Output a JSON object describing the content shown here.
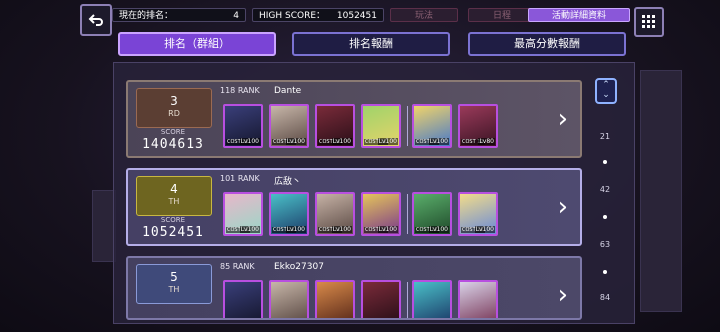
{
  "header": {
    "current_rank_label": "現在的排名：",
    "current_rank_value": "4",
    "high_score_label": "HIGH SCORE：",
    "high_score_value": "1052451",
    "btn_rules": "玩法",
    "btn_schedule": "日程",
    "btn_event_details": "活動詳細資料"
  },
  "tabs": [
    {
      "label": "排名（群組）",
      "active": true
    },
    {
      "label": "排名報酬",
      "active": false
    },
    {
      "label": "最高分數報酬",
      "active": false
    }
  ],
  "rows": [
    {
      "rank": "3",
      "suffix": "RD",
      "score_label": "SCORE",
      "score": "1404613",
      "prev_rank": "118 RANK",
      "name": "Dante",
      "cards": [
        {
          "lv": "Lv100",
          "cost": "COST 12",
          "color": "#3a3f7a"
        },
        {
          "lv": "Lv100",
          "cost": "COST 12",
          "color": "#c7b6a9"
        },
        {
          "lv": "Lv100",
          "cost": "COST 12",
          "color": "#7a2b3a"
        },
        {
          "lv": "Lv100",
          "cost": "COST 12",
          "color": "#9fd36a"
        },
        {
          "lv": "Lv100",
          "cost": "COST 12",
          "color": "#f0d36a"
        },
        {
          "lv": "Lv80",
          "cost": "COST 12",
          "color": "#9a3a5a"
        }
      ]
    },
    {
      "rank": "4",
      "suffix": "TH",
      "score_label": "SCORE",
      "score": "1052451",
      "prev_rank": "101 RANK",
      "name": "広敌丶",
      "cards": [
        {
          "lv": "Lv100",
          "cost": "COST 12",
          "color": "#e7b7c9"
        },
        {
          "lv": "Lv100",
          "cost": "COST 12",
          "color": "#4ac0c8"
        },
        {
          "lv": "Lv100",
          "cost": "COST 12",
          "color": "#c6b2a6"
        },
        {
          "lv": "Lv100",
          "cost": "COST 12",
          "color": "#e5c55a"
        },
        {
          "lv": "Lv100",
          "cost": "COST 12",
          "color": "#5aae6b"
        },
        {
          "lv": "Lv100",
          "cost": "COST 12",
          "color": "#f2dc8a"
        }
      ]
    },
    {
      "rank": "5",
      "suffix": "TH",
      "score_label": "",
      "score": "",
      "prev_rank": "85 RANK",
      "name": "Ekko27307",
      "cards": [
        {
          "lv": "",
          "cost": "",
          "color": "#3a3f7a"
        },
        {
          "lv": "",
          "cost": "",
          "color": "#c7b6a9"
        },
        {
          "lv": "",
          "cost": "",
          "color": "#d88a4a"
        },
        {
          "lv": "",
          "cost": "",
          "color": "#7a2b3a"
        },
        {
          "lv": "",
          "cost": "",
          "color": "#4ac0c8"
        },
        {
          "lv": "",
          "cost": "",
          "color": "#d9d2e8"
        }
      ]
    }
  ],
  "scrollbar": {
    "ticks": [
      "21",
      "42",
      "63",
      "84"
    ]
  },
  "icons": {
    "back": "back-arrow-icon",
    "grid": "grid-menu-icon",
    "chevron": "chevron-right-icon",
    "scroll": "double-chevron-icon"
  },
  "colors": {
    "accent_purple": "#8a57d9",
    "tab_border": "#7b72d2"
  }
}
